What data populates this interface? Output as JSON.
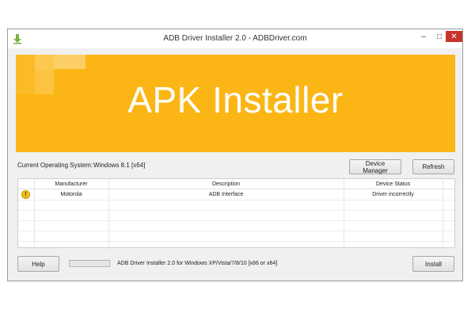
{
  "window": {
    "title": "ADB Driver Installer 2.0 - ADBDriver.com",
    "controls": {
      "minimize": "–",
      "maximize": "□",
      "close": "✕"
    }
  },
  "banner": {
    "title": "APK Installer",
    "background_color": "#fbb615"
  },
  "system": {
    "label": "Current Operating System:",
    "value": "Windows 8.1  [x64]"
  },
  "buttons": {
    "device_manager": "Device Manager",
    "refresh": "Refresh",
    "help": "Help",
    "install": "Install"
  },
  "table": {
    "columns": [
      "Manufacturer",
      "Description",
      "Device Status"
    ],
    "rows": [
      {
        "icon": "warning-icon",
        "manufacturer": "Motorola",
        "description": "ADB Interface",
        "status": "Driver incorrectly"
      }
    ]
  },
  "footer": {
    "progress": 0,
    "status_text": "ADB Driver Installer 2.0 for Windows XP/Vista/7/8/10 [x86 or x64]"
  }
}
